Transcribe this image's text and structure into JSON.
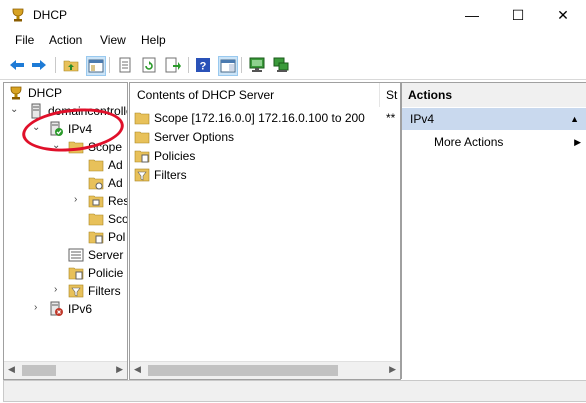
{
  "window": {
    "title": "DHCP",
    "minimize": "—",
    "maximize": "☐",
    "close": "✕"
  },
  "menu": {
    "file": "File",
    "action": "Action",
    "view": "View",
    "help": "Help"
  },
  "toolbar": [
    "back",
    "forward",
    "up",
    "show-hide-tree",
    "properties",
    "refresh",
    "export-list",
    "help",
    "show-hide-action-pane",
    "server-green",
    "server-add"
  ],
  "tree": {
    "root": "DHCP",
    "server": "domaincontroller",
    "ipv4": "IPv4",
    "scope": "Scope",
    "scope_children": [
      "Ad",
      "Ad",
      "Res",
      "Sco",
      "Pol"
    ],
    "server_options": "Server",
    "policies": "Policie",
    "filters": "Filters",
    "ipv6": "IPv6"
  },
  "content": {
    "header": "Contents of DHCP Server",
    "status_header": "St",
    "rows": [
      {
        "label": "Scope [172.16.0.0] 172.16.0.100 to 200",
        "status": "**"
      },
      {
        "label": "Server Options",
        "status": ""
      },
      {
        "label": "Policies",
        "status": ""
      },
      {
        "label": "Filters",
        "status": ""
      }
    ]
  },
  "actions": {
    "header": "Actions",
    "section": "IPv4",
    "more": "More Actions"
  },
  "colors": {
    "accent": "#c9d9ee",
    "annotation": "#e0102a"
  }
}
